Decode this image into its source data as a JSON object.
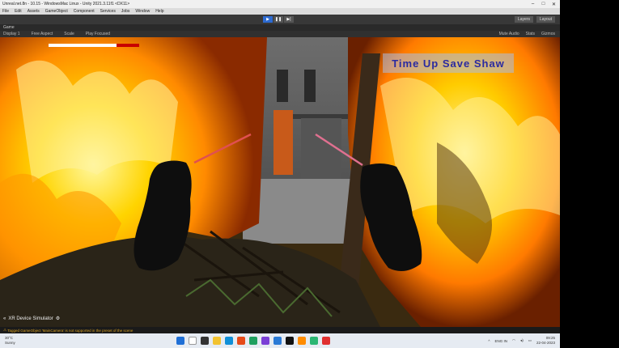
{
  "window": {
    "title": "Unreal.net.8n - 10.15 - WindowsMac Linux - Unity 2021.3.11f1 <DX11>",
    "controls": [
      "–",
      "□",
      "✕"
    ]
  },
  "menu": [
    "File",
    "Edit",
    "Assets",
    "GameObject",
    "Component",
    "Services",
    "Jobs",
    "Window",
    "Help"
  ],
  "toolbar": {
    "right": [
      "Layers",
      "Layout"
    ]
  },
  "game_view": {
    "tab": "Game",
    "options": [
      "Display 1",
      "Free Aspect",
      "Scale",
      "Play Focused"
    ],
    "right_options": [
      "Mute Audio",
      "Stats",
      "Gizmos"
    ]
  },
  "hud": {
    "health_fraction": 0.75,
    "score_text": "Time Up Save Shaw"
  },
  "xr_simulator_label": "XR Device Simulator",
  "status_message": "Tagged GameObject 'MainCamera' is not supported in the preset of the scene",
  "taskbar": {
    "weather_temp": "30°C",
    "weather_desc": "Sunny",
    "lang": "ENG IN",
    "time": "09:25",
    "date": "22-04-2023"
  },
  "colors": {
    "accent": "#2d6bd1",
    "health": "#c80000",
    "status_warn": "#d8a020"
  }
}
